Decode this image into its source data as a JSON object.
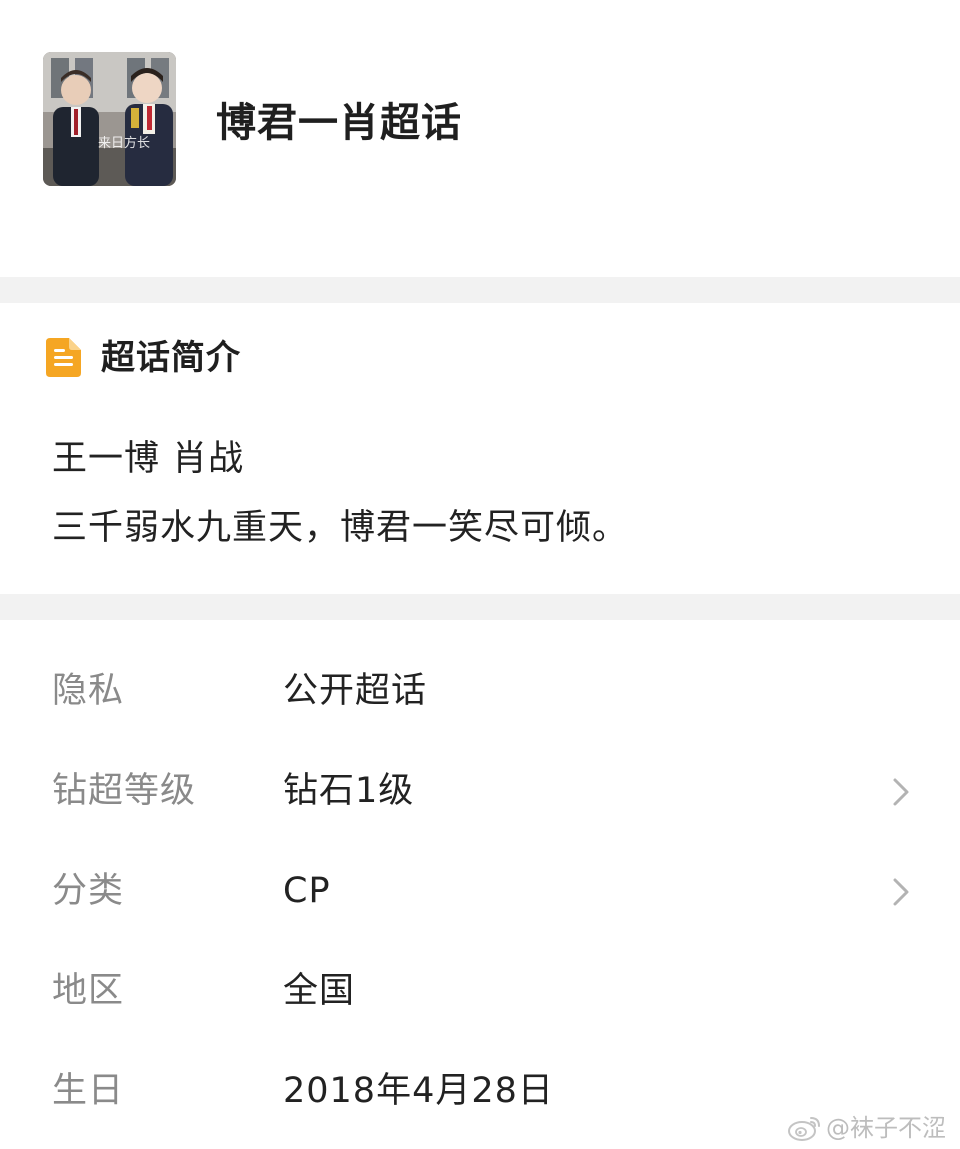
{
  "header": {
    "topic_title": "博君一肖超话",
    "cover_image": "super-topic-cover"
  },
  "intro": {
    "heading": "超话简介",
    "heading_icon": "document-icon",
    "heading_icon_color": "#f5a623",
    "lines": [
      "王一博 肖战",
      "三千弱水九重天，博君一笑尽可倾。"
    ]
  },
  "info": {
    "rows": [
      {
        "label": "隐私",
        "value": "公开超话",
        "has_chevron": false
      },
      {
        "label": "钻超等级",
        "value": "钻石1级",
        "has_chevron": true
      },
      {
        "label": "分类",
        "value": "CP",
        "has_chevron": true
      },
      {
        "label": "地区",
        "value": "全国",
        "has_chevron": false
      },
      {
        "label": "生日",
        "value": "2018年4月28日",
        "has_chevron": false
      }
    ]
  },
  "watermark": {
    "text": "@袜子不涩",
    "icon": "weibo-logo-icon"
  },
  "colors": {
    "accent": "#f5a623",
    "divider": "#f2f2f2",
    "label": "#8a8a8a",
    "chevron": "#b3b3b3"
  }
}
